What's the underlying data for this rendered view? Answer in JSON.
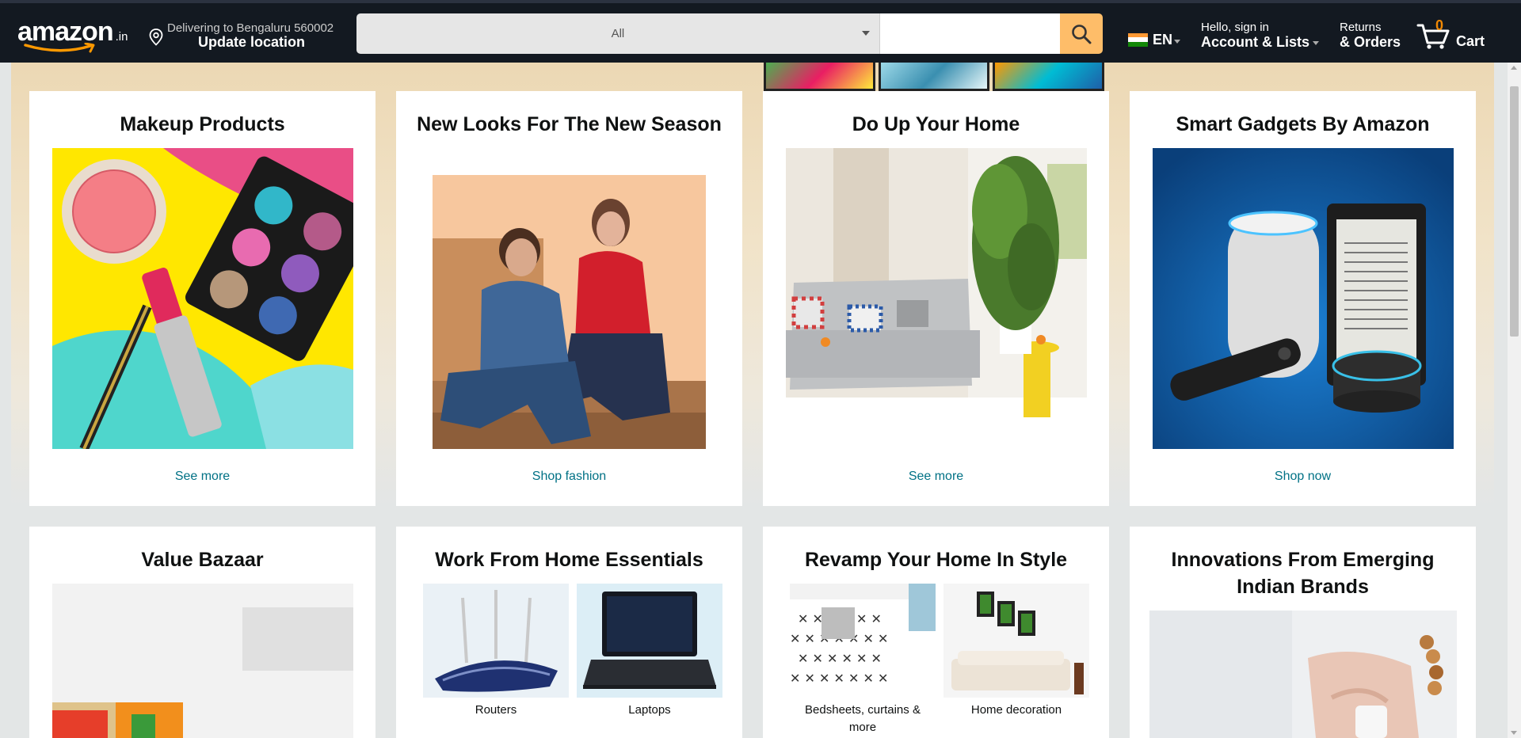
{
  "header": {
    "logo_text": "amazon",
    "logo_tld": ".in",
    "location_line1": "Delivering to Bengaluru 560002",
    "location_line2": "Update location",
    "search_category": "All",
    "search_placeholder": "",
    "language": "EN",
    "account_line1": "Hello, sign in",
    "account_line2": "Account & Lists",
    "returns_line1": "Returns",
    "returns_line2": "& Orders",
    "cart_count": "0",
    "cart_label": "Cart",
    "colors": {
      "bar": "#131921",
      "search_button": "#febd69",
      "cart_count": "#f08804"
    }
  },
  "cards": [
    {
      "title": "Makeup Products",
      "link": "See more",
      "image": "makeup-products-image"
    },
    {
      "title": "New Looks For The New Season",
      "link": "Shop fashion",
      "image": "fashion-couple-image"
    },
    {
      "title": "Do Up Your Home",
      "link": "See more",
      "image": "living-room-image"
    },
    {
      "title": "Smart Gadgets By Amazon",
      "link": "Shop now",
      "image": "smart-gadgets-image"
    }
  ],
  "row2": {
    "value_bazaar": {
      "title": "Value Bazaar",
      "image": "groceries-image"
    },
    "wfh": {
      "title": "Work From Home Essentials",
      "items": [
        {
          "label": "Routers",
          "icon": "router-image"
        },
        {
          "label": "Laptops",
          "icon": "laptop-image"
        }
      ]
    },
    "revamp": {
      "title": "Revamp Your Home In Style",
      "items": [
        {
          "label": "Bedsheets, curtains & more",
          "icon": "bedsheets-image"
        },
        {
          "label": "Home decoration",
          "icon": "home-decor-image"
        }
      ]
    },
    "innovations": {
      "title": "Innovations From Emerging Indian Brands",
      "image": "hand-product-image"
    }
  }
}
